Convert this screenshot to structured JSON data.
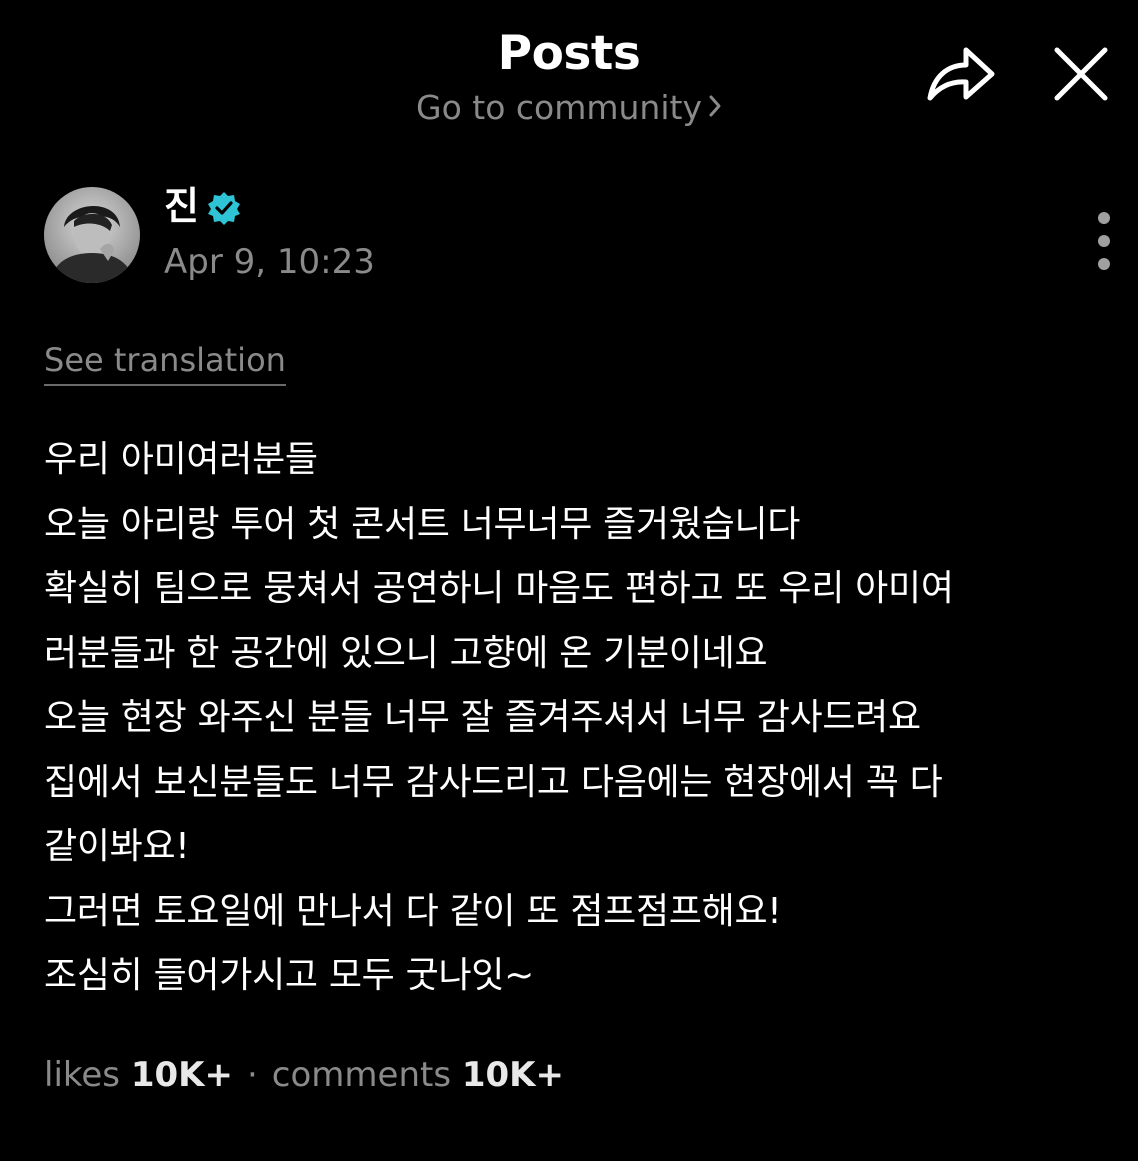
{
  "header": {
    "title": "Posts",
    "community_link": "Go to community",
    "share_icon": "share-arrow-icon",
    "close_icon": "close-icon"
  },
  "post": {
    "author": "진",
    "verified_icon": "verified-badge-icon",
    "verified_color": "#2ec4d6",
    "time": "Apr 9, 10:23",
    "see_translation": "See translation",
    "lines": [
      "우리 아미여러분들",
      "오늘 아리랑 투어 첫 콘서트 너무너무 즐거웠습니다",
      "확실히 팀으로 뭉쳐서 공연하니 마음도 편하고 또 우리 아미여",
      "러분들과 한 공간에 있으니 고향에 온 기분이네요",
      "오늘 현장 와주신 분들 너무 잘 즐겨주셔서 너무 감사드려요",
      "집에서 보신분들도 너무 감사드리고 다음에는 현장에서 꼭 다",
      "같이봐요!",
      "그러면 토요일에 만나서 다 같이 또 점프점프해요!",
      "조심히 들어가시고 모두 굿나잇~"
    ],
    "stats": {
      "likes_label": "likes",
      "likes_value": "10K+",
      "comments_label": "comments",
      "comments_value": "10K+"
    }
  }
}
